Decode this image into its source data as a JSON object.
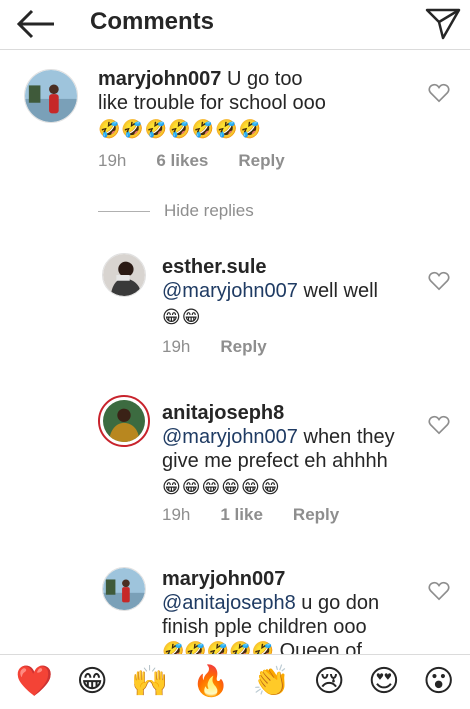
{
  "header": {
    "title": "Comments"
  },
  "comments": [
    {
      "username": "maryjohn007",
      "text_line1": "U go too",
      "text_line2": "like trouble for school ooo",
      "emojis": "🤣🤣🤣🤣🤣🤣🤣",
      "time": "19h",
      "likes": "6 likes",
      "reply": "Reply"
    }
  ],
  "hide_replies": "Hide replies",
  "replies": [
    {
      "username": "esther.sule",
      "mention": "@maryjohn007",
      "text": " well well",
      "emojis": "😁😁",
      "time": "19h",
      "reply": "Reply"
    },
    {
      "username": "anitajoseph8",
      "mention": "@maryjohn007",
      "text_line1": " when they",
      "text_line2": "give me prefect eh ahhhh",
      "emojis": "😁😁😁😁😁😁",
      "time": "19h",
      "likes": "1 like",
      "reply": "Reply"
    },
    {
      "username": "maryjohn007",
      "mention": "@anitajoseph8",
      "text_line1": " u go don",
      "text_line2": "finish pple children ooo",
      "emojis": "🤣🤣🤣🤣🤣",
      "text_line3": " Queen of"
    }
  ],
  "emoji_bar": [
    "❤️",
    "😁",
    "🙌",
    "🔥",
    "👏",
    "😢",
    "😍",
    "😮"
  ],
  "icons": {
    "back": "arrow-left-icon",
    "send": "paper-plane-icon",
    "like": "heart-outline-icon"
  },
  "colors": {
    "text": "#262626",
    "secondary": "#8e8e8e",
    "mention": "#1f3b63",
    "story_ring": "#c8232c"
  }
}
